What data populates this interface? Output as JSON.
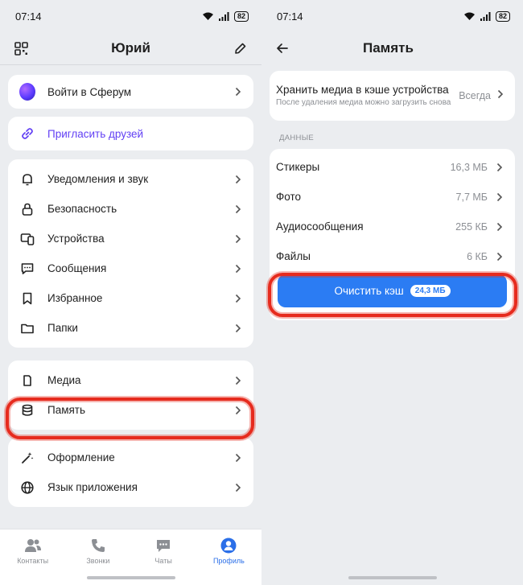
{
  "left": {
    "status": {
      "time": "07:14",
      "battery": "82"
    },
    "header": {
      "title": "Юрий"
    },
    "sferum": {
      "label": "Войти в Сферум"
    },
    "invite": {
      "label": "Пригласить друзей"
    },
    "group1": [
      {
        "label": "Уведомления и звук",
        "icon": "bell-icon"
      },
      {
        "label": "Безопасность",
        "icon": "lock-icon"
      },
      {
        "label": "Устройства",
        "icon": "devices-icon"
      },
      {
        "label": "Сообщения",
        "icon": "message-icon"
      },
      {
        "label": "Избранное",
        "icon": "bookmark-icon"
      },
      {
        "label": "Папки",
        "icon": "folder-icon"
      }
    ],
    "group2": [
      {
        "label": "Медиа",
        "icon": "media-icon"
      },
      {
        "label": "Память",
        "icon": "storage-icon"
      }
    ],
    "group3": [
      {
        "label": "Оформление",
        "icon": "magic-wand-icon"
      },
      {
        "label": "Язык приложения",
        "icon": "globe-icon"
      }
    ],
    "tabs": [
      {
        "label": "Контакты",
        "icon": "contacts-icon"
      },
      {
        "label": "Звонки",
        "icon": "phone-icon"
      },
      {
        "label": "Чаты",
        "icon": "chat-icon"
      },
      {
        "label": "Профиль",
        "icon": "profile-icon",
        "active": true
      }
    ]
  },
  "right": {
    "status": {
      "time": "07:14",
      "battery": "82"
    },
    "header": {
      "title": "Память"
    },
    "cache": {
      "title": "Хранить медиа в кэше устройства",
      "subtitle": "После удаления медиа можно загрузить снова",
      "value": "Всегда"
    },
    "section_caption": "ДАННЫЕ",
    "data_rows": [
      {
        "label": "Стикеры",
        "value": "16,3 МБ"
      },
      {
        "label": "Фото",
        "value": "7,7 МБ"
      },
      {
        "label": "Аудиосообщения",
        "value": "255 КБ"
      },
      {
        "label": "Файлы",
        "value": "6 КБ"
      }
    ],
    "clear_button": {
      "label": "Очистить кэш",
      "size": "24,3 МБ"
    }
  },
  "colors": {
    "accent": "#2b7cf3",
    "highlight": "#e62b1e",
    "invite": "#6240f4",
    "background": "#ebedf0"
  }
}
